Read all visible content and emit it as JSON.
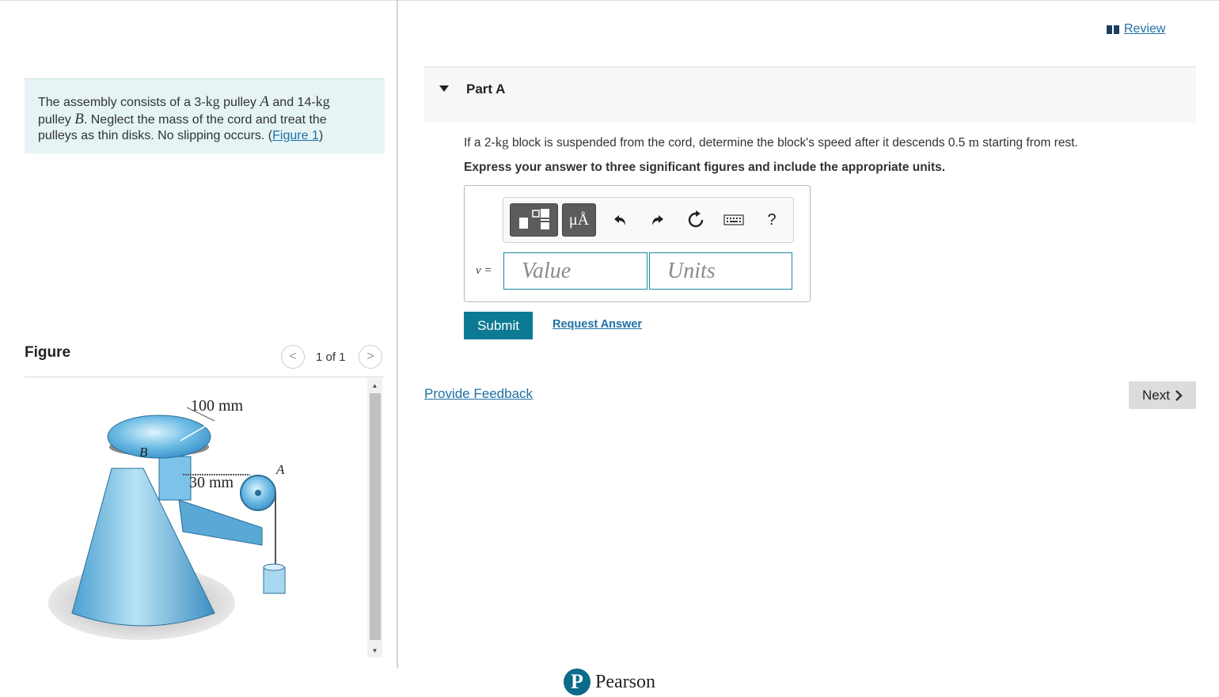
{
  "problem": {
    "t1": "The assembly consists of a 3-",
    "unit_kg": "kg",
    "t2": " pulley ",
    "var_a": "A",
    "t3": " and 14-",
    "t4": "pulley ",
    "var_b": "B",
    "t5": ". Neglect the mass of the cord and treat the",
    "t6": "pulleys as thin disks. No slipping occurs. (",
    "figure_link": "Figure 1",
    "t7": ")"
  },
  "figure": {
    "title": "Figure",
    "counter": "1 of 1",
    "prev_symbol": "<",
    "next_symbol": ">",
    "labels": {
      "radius_b": "100 mm",
      "radius_a": "30 mm",
      "pulley_b": "B",
      "pulley_a": "A"
    }
  },
  "review": {
    "label": "Review"
  },
  "part": {
    "title": "Part A",
    "q1": "If a 2-",
    "q_unit": "kg",
    "q2": " block is suspended from the cord, determine the block's speed after it descends 0.5 ",
    "q_unit2": "m",
    "q3": " starting from rest.",
    "instruction": "Express your answer to three significant figures and include the appropriate units."
  },
  "toolbar": {
    "units_label": "μÅ",
    "help": "?",
    "icons": [
      "templates-icon",
      "units-icon",
      "undo-icon",
      "redo-icon",
      "reset-icon",
      "keyboard-icon",
      "help-icon"
    ]
  },
  "answer": {
    "variable": "v =",
    "value_placeholder": "Value",
    "units_placeholder": "Units"
  },
  "actions": {
    "submit": "Submit",
    "request": "Request Answer",
    "feedback": "Provide Feedback",
    "next": "Next"
  },
  "footer": {
    "brand": "Pearson",
    "logo_letter": "P"
  },
  "colors": {
    "accent": "#0d7a94",
    "link": "#1d70a5",
    "problem_bg": "#e6f4f5"
  }
}
